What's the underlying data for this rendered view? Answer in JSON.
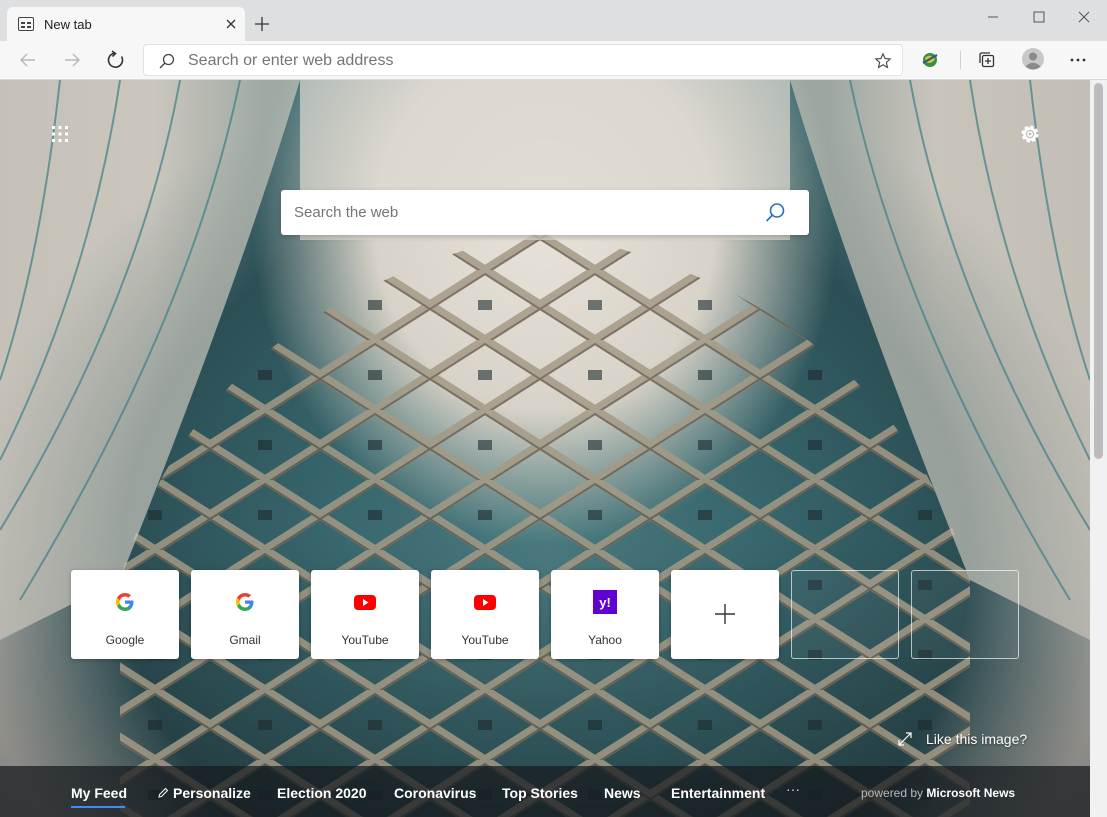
{
  "window": {
    "tab_title": "New tab"
  },
  "toolbar": {
    "address_placeholder": "Search or enter web address"
  },
  "page": {
    "web_search_placeholder": "Search the web",
    "tiles": [
      {
        "label": "Google",
        "icon": "google-icon"
      },
      {
        "label": "Gmail",
        "icon": "google-icon"
      },
      {
        "label": "YouTube",
        "icon": "youtube-icon"
      },
      {
        "label": "YouTube",
        "icon": "youtube-icon"
      },
      {
        "label": "Yahoo",
        "icon": "yahoo-icon"
      }
    ],
    "like_image": "Like this image?",
    "feed_tabs": [
      "My Feed",
      "Personalize",
      "Election 2020",
      "Coronavirus",
      "Top Stories",
      "News",
      "Entertainment"
    ],
    "more": "···",
    "powered_by": "powered by",
    "powered_brand": "Microsoft News"
  },
  "colors": {
    "accent": "#3b8df2",
    "youtube_red": "#ff0000",
    "yahoo_purple": "#6001d2"
  }
}
